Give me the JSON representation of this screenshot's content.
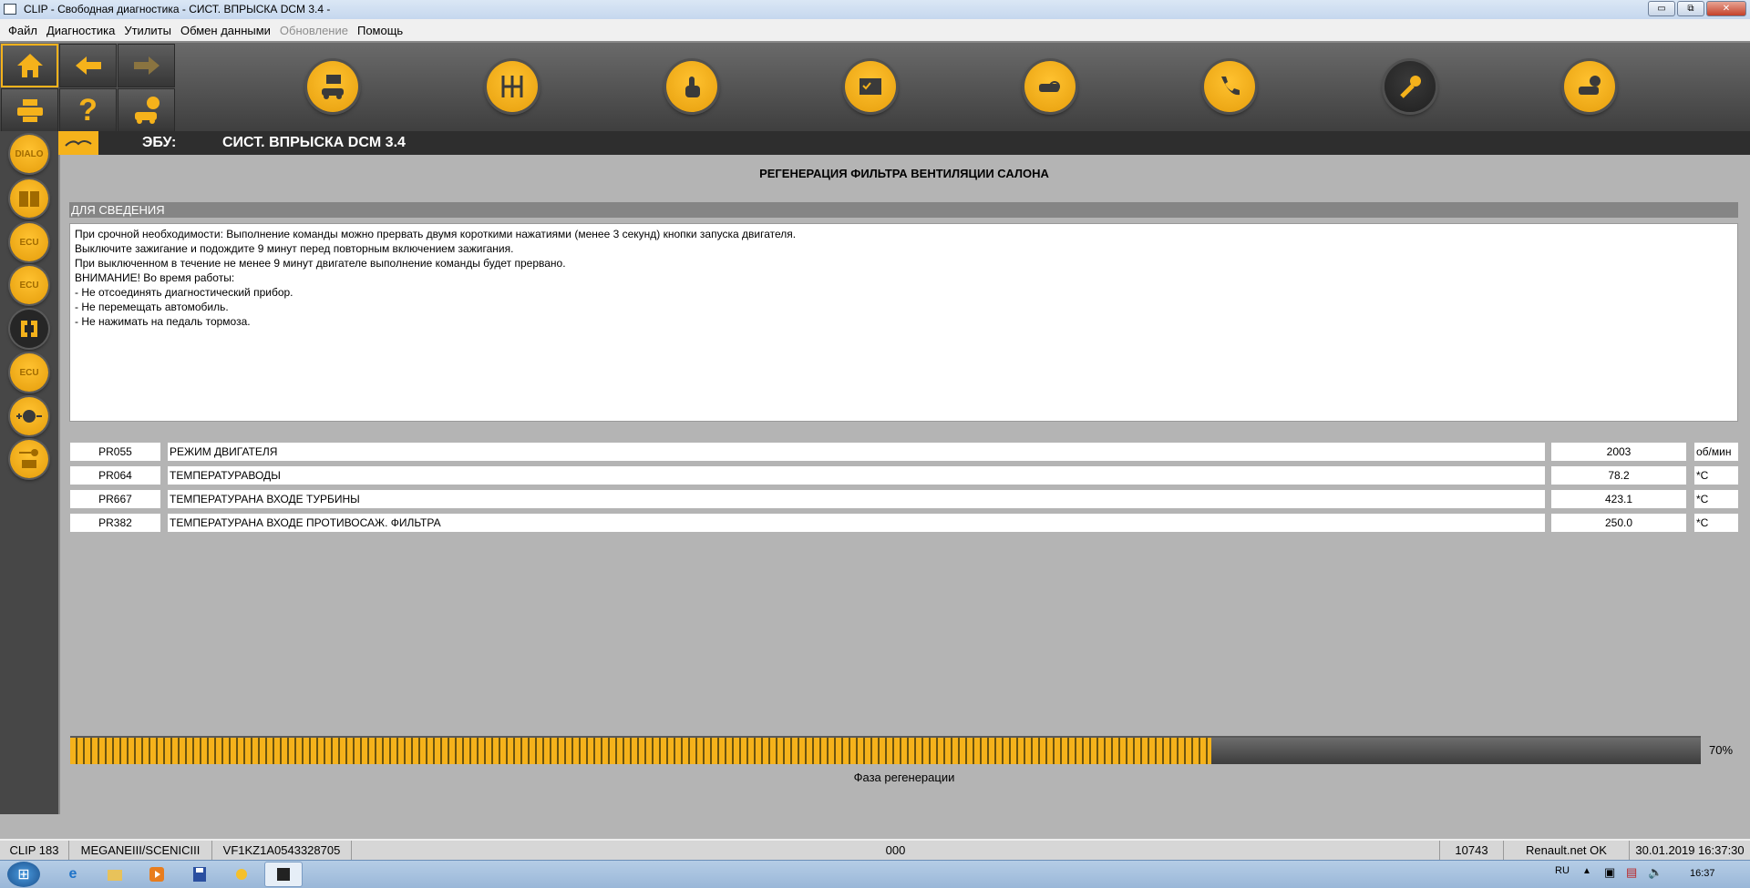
{
  "window": {
    "title": "CLIP - Свободная диагностика - СИСТ. ВПРЫСКА DCM 3.4 -",
    "minimize": "▭",
    "maximize": "⧉",
    "close": "✕"
  },
  "menu": [
    "Файл",
    "Диагностика",
    "Утилиты",
    "Обмен данными",
    "Обновление",
    "Помощь"
  ],
  "toolbar": {
    "left_buttons": [
      "home-icon",
      "arrow-left-icon",
      "arrow-right-icon",
      "printer-icon",
      "help-icon",
      "vehicle-info-icon"
    ],
    "help_glyph": "?",
    "main_buttons": [
      "vehicle-message-icon",
      "gearbox-icon",
      "touch-icon",
      "checklist-icon",
      "vehicle-search-icon",
      "phone-icon",
      "wrench-icon",
      "vehicle-check-icon"
    ]
  },
  "sidebar": {
    "dialo_label": "DIALO",
    "ecu_label": "ECU",
    "items": [
      "dialo-icon",
      "manual-book-icon",
      "ecu-binary-icon",
      "ecu-checklist-icon",
      "bracket-icon",
      "ecu-document-icon",
      "plus-minus-icon",
      "key-engine-icon"
    ]
  },
  "ecu": {
    "label": "ЭБУ:",
    "name": "СИСТ. ВПРЫСКА DCM 3.4"
  },
  "procedure_title": "РЕГЕНЕРАЦИЯ ФИЛЬТРА ВЕНТИЛЯЦИИ САЛОНА",
  "info": {
    "header": "ДЛЯ СВЕДЕНИЯ",
    "lines": [
      "При срочной необходимости: Выполнение команды можно прервать двумя короткими нажатиями (менее 3 секунд) кнопки запуска двигателя.",
      "Выключите зажигание и подождите 9 минут перед повторным включением зажигания.",
      "При выключенном в течение не менее 9 минут двигателе выполнение команды будет прервано.",
      "ВНИМАНИЕ! Во время работы:",
      "- Не отсоединять диагностический прибор.",
      "- Не перемещать автомобиль.",
      "- Не нажимать на педаль тормоза."
    ]
  },
  "params": [
    {
      "code": "PR055",
      "name": "РЕЖИМ ДВИГАТЕЛЯ",
      "value": "2003",
      "unit": "об/мин"
    },
    {
      "code": "PR064",
      "name": "ТЕМПЕРАТУРАВОДЫ",
      "value": "78.2",
      "unit": "*C"
    },
    {
      "code": "PR667",
      "name": "ТЕМПЕРАТУРАНА ВХОДЕ ТУРБИНЫ",
      "value": "423.1",
      "unit": "*C"
    },
    {
      "code": "PR382",
      "name": "ТЕМПЕРАТУРАНА ВХОДЕ ПРОТИВОСАЖ. ФИЛЬТРА",
      "value": "250.0",
      "unit": "*C"
    }
  ],
  "progress": {
    "percent": 70,
    "label": "70%",
    "caption": "Фаза регенерации"
  },
  "status": {
    "clip": "CLIP 183",
    "vehicle": "MEGANEIII/SCENICIII",
    "vin": "VF1KZ1A0543328705",
    "code": "000",
    "number": "10743",
    "network": "Renault.net OK",
    "datetime": "30.01.2019 16:37:30"
  },
  "taskbar": {
    "lang": "RU",
    "time": "16:37",
    "start": "⊞",
    "apps": [
      "ie-icon",
      "explorer-icon",
      "media-player-icon",
      "save-icon",
      "clip-icon",
      "app-window-icon"
    ]
  },
  "colors": {
    "accent": "#f5b21b",
    "panel": "#b4b4b4",
    "dark": "#2e2e2e"
  }
}
